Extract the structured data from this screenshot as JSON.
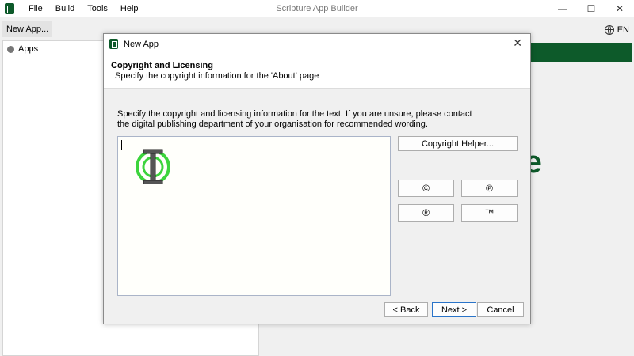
{
  "window": {
    "title": "Scripture App Builder",
    "menu": [
      "File",
      "Build",
      "Tools",
      "Help"
    ],
    "controls": {
      "minimize": "—",
      "maximize": "☐",
      "close": "✕"
    }
  },
  "toolbar": {
    "new_app_label": "New App...",
    "language_label": "EN",
    "language_icon": "globe-icon"
  },
  "sidebar": {
    "items": [
      {
        "label": "Apps",
        "icon": "bullet-icon"
      }
    ]
  },
  "background": {
    "brand_partial_text": "re",
    "brand_color": "#0d5a2a"
  },
  "dialog": {
    "title": "New App",
    "close_glyph": "✕",
    "header": {
      "title": "Copyright and Licensing",
      "subtitle": "Specify the copyright information for the 'About' page"
    },
    "instructions_line1": "Specify the copyright and licensing information for the text. If you are unsure, please contact",
    "instructions_line2": "the digital publishing department of your organisation for recommended wording.",
    "text_value": "",
    "buttons": {
      "helper": "Copyright Helper...",
      "copyright_symbol": "©",
      "phonogram_symbol": "℗",
      "registered_symbol": "®",
      "trademark_symbol": "™",
      "back": "< Back",
      "next": "Next >",
      "cancel": "Cancel"
    }
  },
  "colors": {
    "accent_green": "#0d5a2a",
    "focus_blue": "#2a74c9",
    "cursor_highlight": "#3cd43c"
  }
}
